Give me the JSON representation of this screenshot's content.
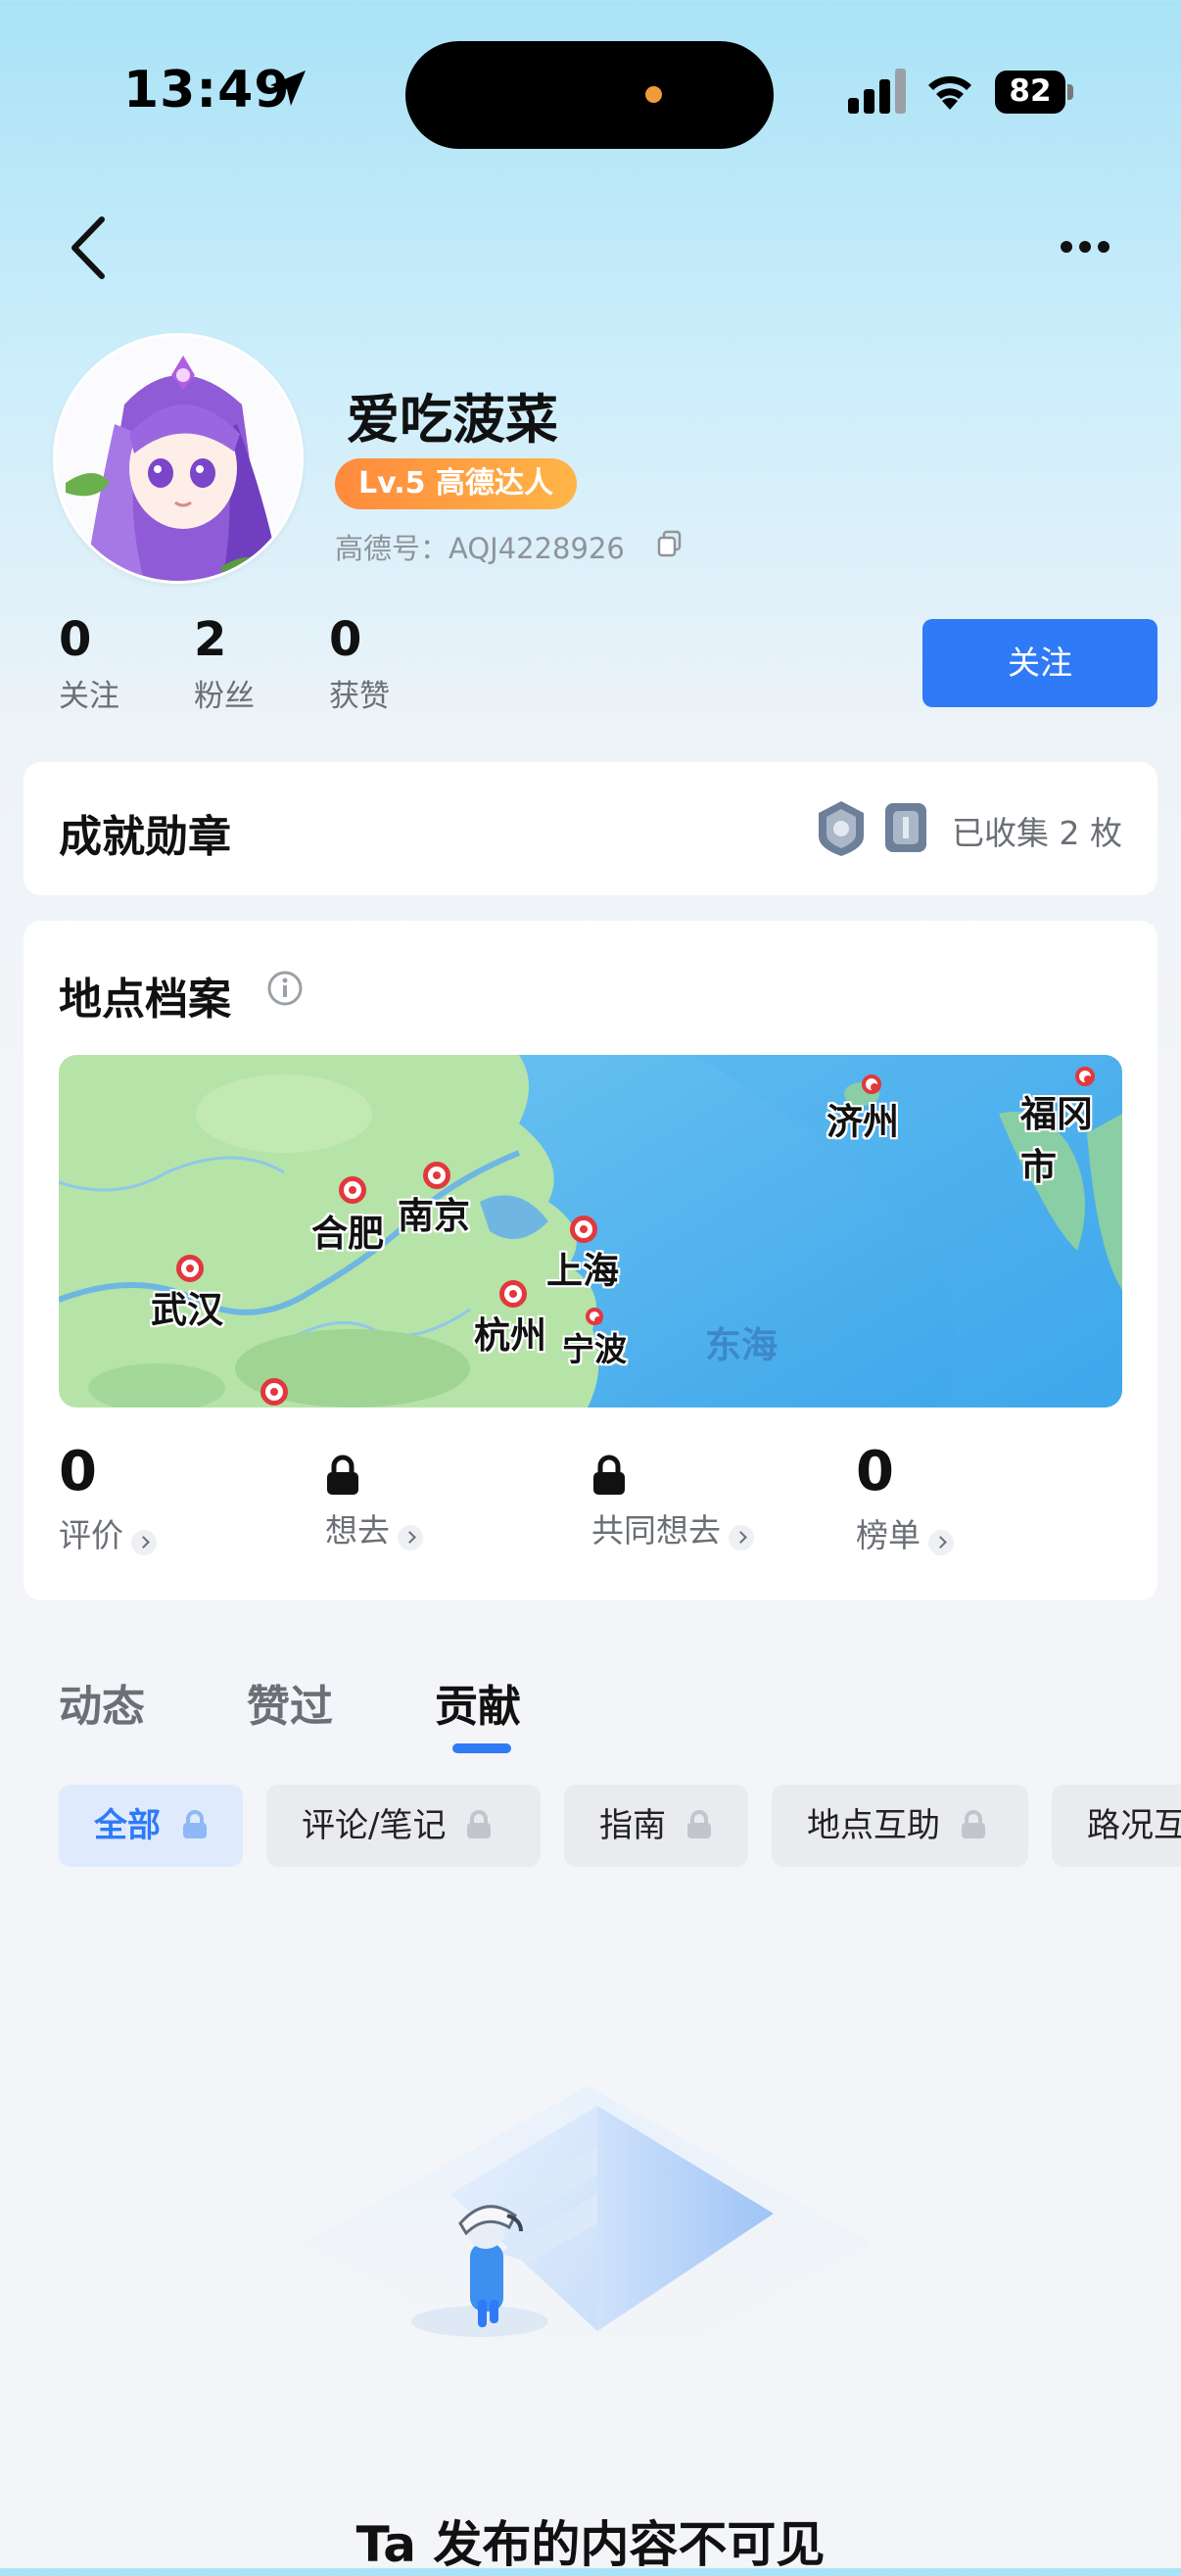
{
  "status_bar": {
    "time": "13:49",
    "battery": "82"
  },
  "profile": {
    "name": "爱吃菠菜",
    "level_badge": "Lv.5 高德达人",
    "gaode_id": "高德号：AQJ4228926",
    "stats": [
      {
        "value": "0",
        "label": "关注"
      },
      {
        "value": "2",
        "label": "粉丝"
      },
      {
        "value": "0",
        "label": "获赞"
      }
    ],
    "follow_button": "关注"
  },
  "achievements": {
    "title": "成就勋章",
    "collected": "已收集 2 枚"
  },
  "places": {
    "title": "地点档案",
    "map": {
      "cities": [
        "济州",
        "福冈市",
        "合肥",
        "南京",
        "上海",
        "武汉",
        "杭州",
        "宁波"
      ],
      "sea_label": "东海"
    },
    "stats": [
      {
        "value": "0",
        "label": "评价",
        "locked": false
      },
      {
        "value": "",
        "label": "想去",
        "locked": true
      },
      {
        "value": "",
        "label": "共同想去",
        "locked": true
      },
      {
        "value": "0",
        "label": "榜单",
        "locked": false
      }
    ]
  },
  "tabs": [
    "动态",
    "赞过",
    "贡献"
  ],
  "active_tab": "贡献",
  "filters": [
    "全部",
    "评论/笔记",
    "指南",
    "地点互助",
    "路况互"
  ],
  "empty_message": "Ta 发布的内容不可见",
  "colors": {
    "accent": "#2f7af6",
    "badge_orange": "#ff9a40"
  }
}
